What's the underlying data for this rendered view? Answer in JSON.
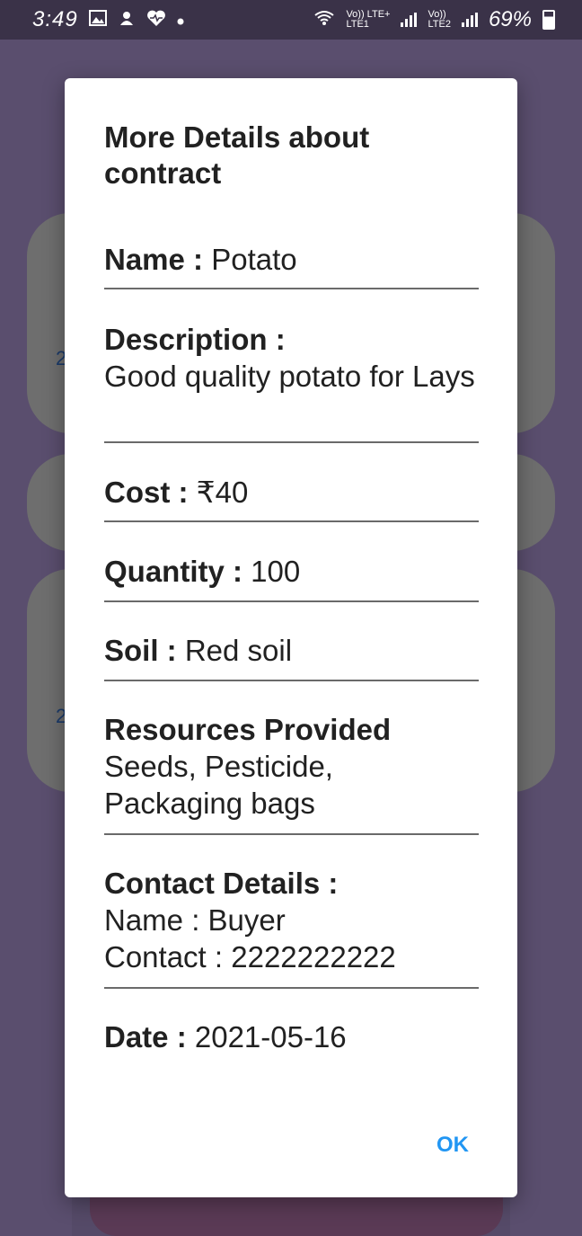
{
  "status_bar": {
    "time": "3:49",
    "network1_top": "Vo)) LTE+",
    "network1_bottom": "LTE1",
    "network2_top": "Vo))",
    "network2_bottom": "LTE2",
    "battery_percent": "69%"
  },
  "background": {
    "edge_char_1": "2",
    "edge_char_2": "2"
  },
  "dialog": {
    "title": "More Details about contract",
    "name_label": "Name :",
    "name_value": "Potato",
    "description_label": "Description :",
    "description_value": "Good quality potato for Lays",
    "cost_label": "Cost :",
    "cost_value": "₹40",
    "quantity_label": "Quantity :",
    "quantity_value": "100",
    "soil_label": "Soil :",
    "soil_value": "Red soil",
    "resources_label": "Resources Provided",
    "resources_value": "Seeds, Pesticide, Packaging bags",
    "contact_label": "Contact Details :",
    "contact_name": "Name : Buyer",
    "contact_phone": "Contact : 2222222222",
    "date_label": "Date :",
    "date_value": "2021-05-16",
    "ok_label": "OK"
  },
  "colors": {
    "accent": "#2196f3",
    "scrim": "#5a4e6e",
    "status_bar": "#3a3248"
  }
}
